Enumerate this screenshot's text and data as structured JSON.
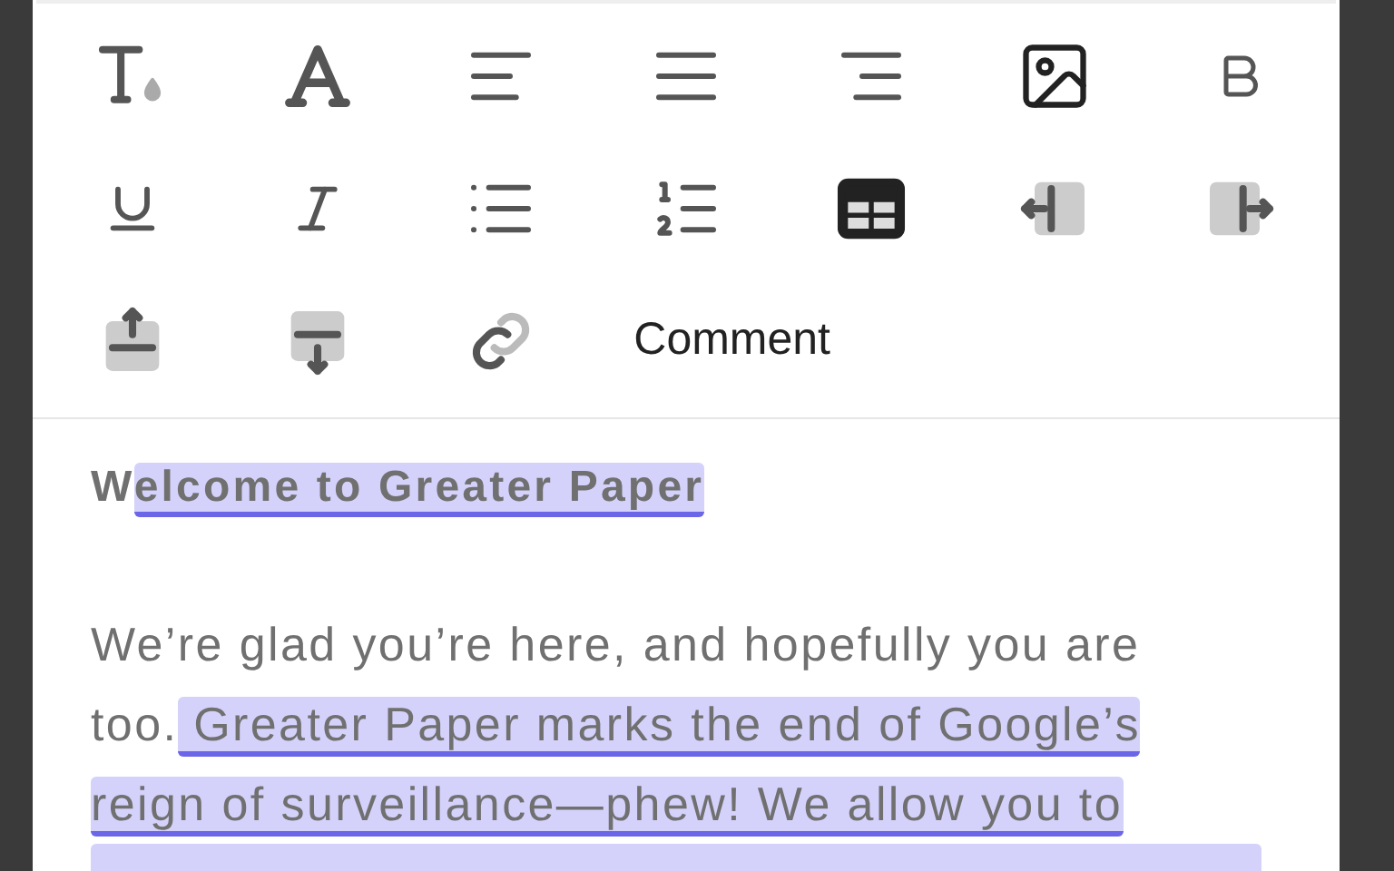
{
  "toolbar": {
    "buttons": [
      {
        "kind": "icon",
        "disabled": false
      },
      {
        "kind": "icon",
        "disabled": false
      },
      {
        "kind": "icon",
        "disabled": false
      },
      {
        "kind": "icon",
        "disabled": false
      },
      {
        "kind": "icon",
        "disabled": false
      },
      {
        "kind": "icon",
        "disabled": false
      },
      {
        "kind": "icon",
        "disabled": false
      },
      {
        "kind": "icon",
        "disabled": false
      },
      {
        "kind": "icon",
        "disabled": false
      },
      {
        "kind": "icon",
        "disabled": false
      },
      {
        "kind": "icon",
        "disabled": false
      },
      {
        "kind": "icon",
        "disabled": false
      },
      {
        "kind": "icon",
        "disabled": true
      },
      {
        "kind": "icon",
        "disabled": true
      },
      {
        "kind": "icon",
        "disabled": true
      },
      {
        "kind": "icon",
        "disabled": true
      },
      {
        "kind": "icon",
        "disabled": false
      },
      {
        "kind": "text",
        "label": "Comment",
        "disabled": false
      }
    ]
  },
  "document": {
    "heading": [
      {
        "text": "W",
        "highlighted": false
      },
      {
        "text": "elcome to Greater Paper",
        "highlighted": true
      }
    ],
    "paragraph_lines": [
      [
        {
          "text": "We’re glad you’re here, and hopefully you are",
          "highlighted": false
        }
      ],
      [
        {
          "text": "too.",
          "highlighted": false
        },
        {
          "text": " Greater Paper marks the end of Google’s",
          "highlighted": true
        }
      ],
      [
        {
          "text": "reign of surveillance—phew! We allow you to",
          "highlighted": true
        }
      ],
      [
        {
          "highlighted": true
        }
      ]
    ]
  }
}
